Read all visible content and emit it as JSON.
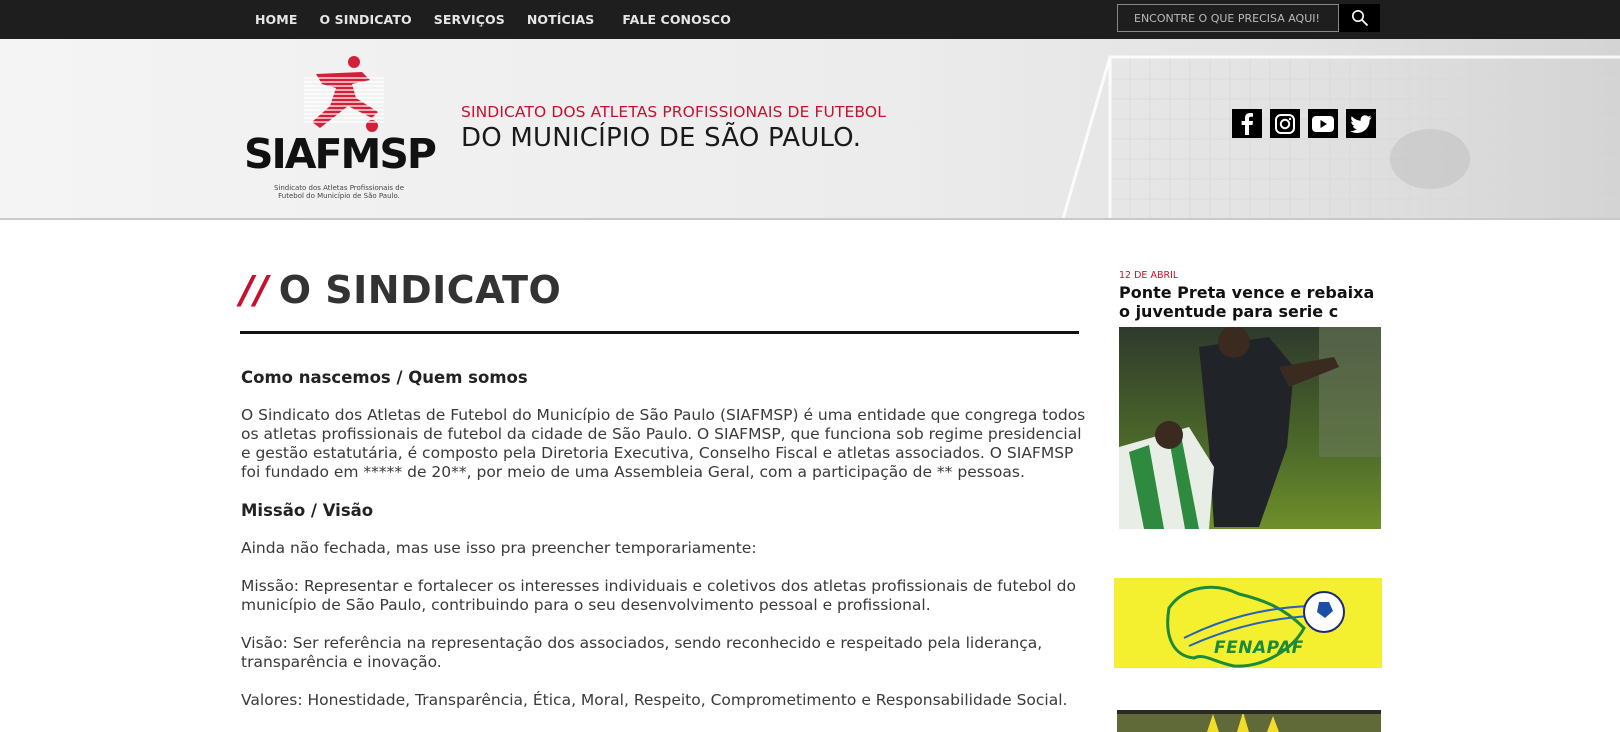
{
  "nav": {
    "items": [
      "HOME",
      "O SINDICATO",
      "SERVIÇOS",
      "NOTÍCIAS",
      "FALE CONOSCO"
    ]
  },
  "search": {
    "placeholder": "ENCONTRE O QUE PRECISA AQUI!",
    "icon": "search-icon"
  },
  "header": {
    "logo_text": "SIAFMSP",
    "logo_subtitle": "Sindicato dos Atletas Profissionais de Futebol do Município de São Paulo.",
    "tagline_top": "SINDICATO DOS ATLETAS PROFISSIONAIS DE FUTEBOL",
    "tagline_bottom": "DO MUNICÍPIO DE SÃO PAULO.",
    "social": [
      "facebook-icon",
      "instagram-icon",
      "youtube-icon",
      "twitter-icon"
    ]
  },
  "main": {
    "title_prefix": "//",
    "title": "O SINDICATO",
    "heading1": "Como nascemos / Quem somos",
    "para1": "O Sindicato dos Atletas de Futebol do Município de São Paulo (SIAFMSP) é uma entidade que congrega todos os atletas profissionais de futebol da cidade de São Paulo. O SIAFMSP, que funciona sob regime presidencial e gestão estatutária, é composto pela Diretoria Executiva, Conselho Fiscal e atletas associados. O SIAFMSP foi fundado em ***** de 20**, por meio de uma Assembleia Geral, com a participação de ** pessoas.",
    "heading2": "Missão / Visão",
    "para2": "Ainda não fechada, mas use isso pra preencher temporariamente:",
    "para3": "Missão: Representar e fortalecer os interesses individuais e coletivos dos atletas profissionais de futebol do município de São Paulo, contribuindo para o seu desenvolvimento pessoal e profissional.",
    "para4": "Visão: Ser referência na representação dos associados, sendo reconhecido e respeitado pela liderança, transparência e inovação.",
    "para5": "Valores: Honestidade, Transparência, Ética, Moral, Respeito, Comprometimento e Responsabilidade Social."
  },
  "sidebar": {
    "news_date": "12 DE ABRIL",
    "news_title": "Ponte Preta vence e rebaixa o juventude para serie c",
    "banner_text": "FENAPAF"
  },
  "colors": {
    "accent": "#c8102e",
    "topbar": "#1e1e1e",
    "fenapaf_bg": "#f4f02f"
  }
}
